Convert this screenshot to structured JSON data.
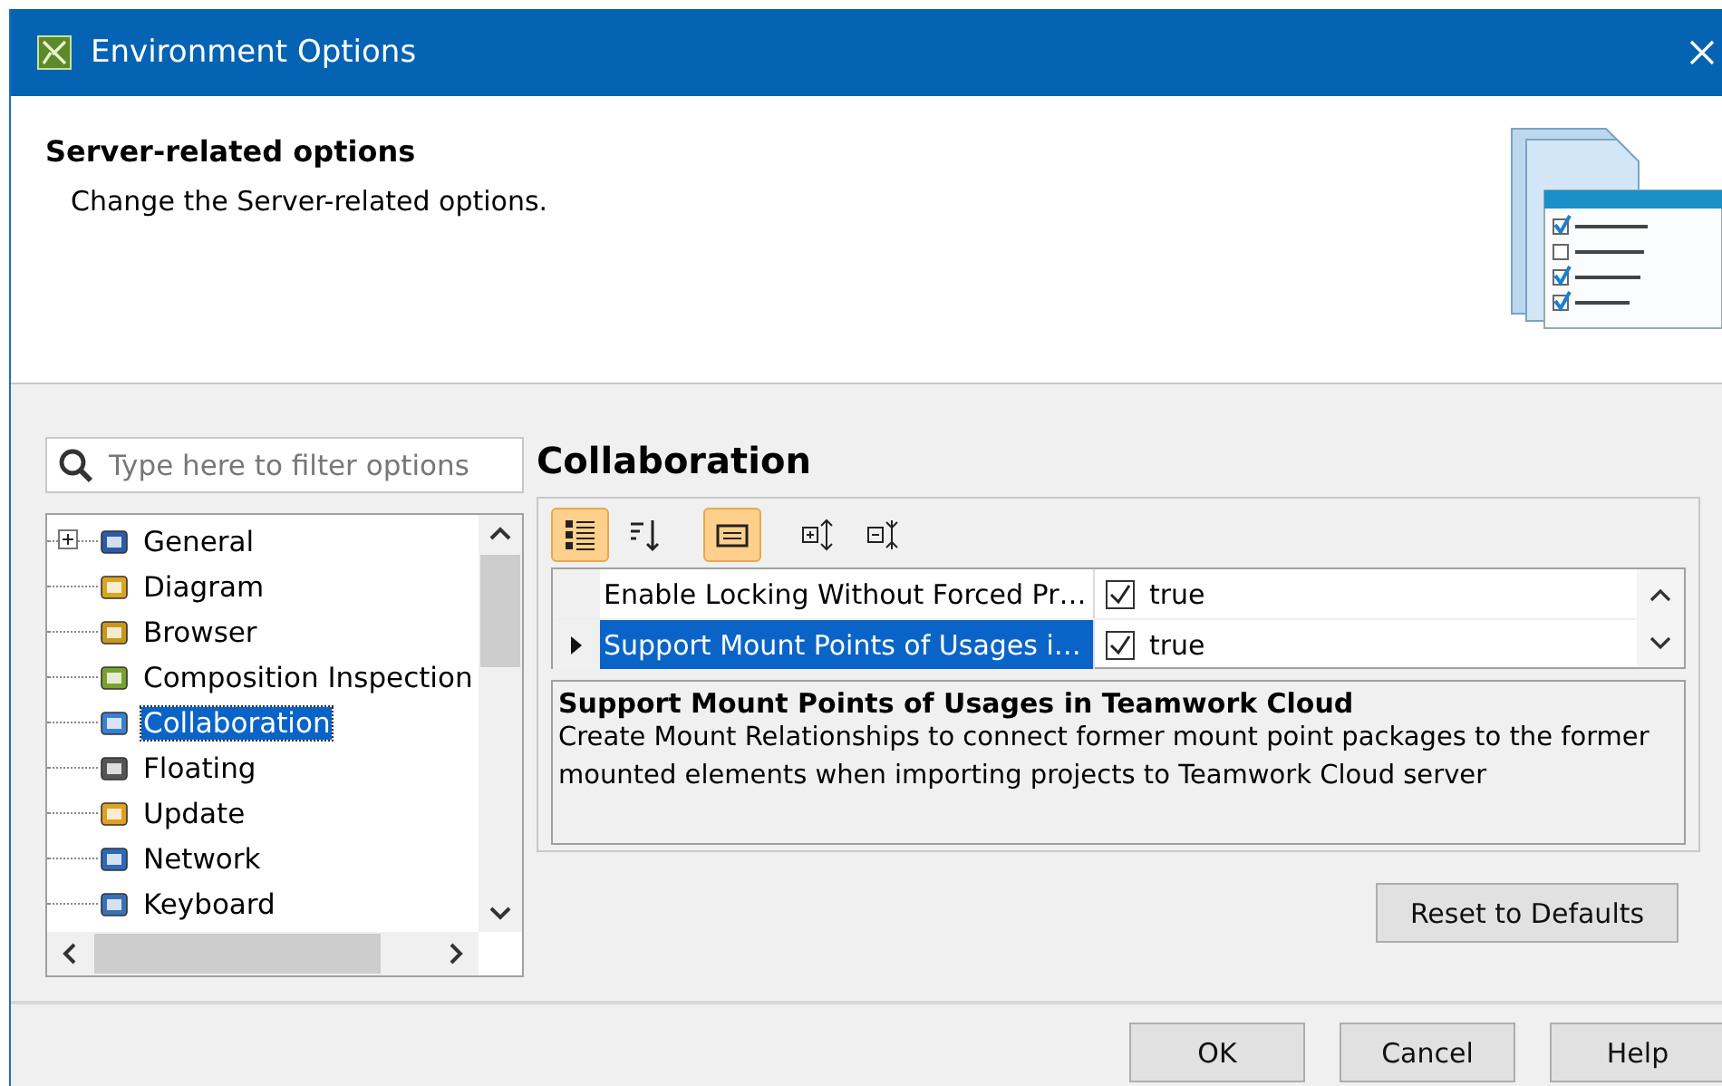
{
  "window": {
    "title": "Environment Options"
  },
  "header": {
    "title": "Server-related options",
    "subtitle": "Change the Server-related options."
  },
  "filter": {
    "placeholder": "Type here to filter options"
  },
  "tree": {
    "items": [
      {
        "label": "General",
        "selected": false,
        "expanded": false
      },
      {
        "label": "Diagram",
        "selected": false
      },
      {
        "label": "Browser",
        "selected": false
      },
      {
        "label": "Composition Inspection",
        "selected": false
      },
      {
        "label": "Collaboration",
        "selected": true
      },
      {
        "label": "Floating",
        "selected": false
      },
      {
        "label": "Update",
        "selected": false
      },
      {
        "label": "Network",
        "selected": false
      },
      {
        "label": "Keyboard",
        "selected": false
      }
    ]
  },
  "panel": {
    "title": "Collaboration",
    "toolbar": [
      {
        "kind": "categorized",
        "selected": true
      },
      {
        "kind": "sort",
        "selected": false
      },
      {
        "kind": "description",
        "selected": true
      },
      {
        "kind": "expand",
        "selected": false
      },
      {
        "kind": "collapse",
        "selected": false
      }
    ],
    "properties": [
      {
        "name": "Enable Locking Without Forced Pr…",
        "checked": true,
        "value": "true",
        "selected": false
      },
      {
        "name": "Support Mount Points of Usages i…",
        "checked": true,
        "value": "true",
        "selected": true
      }
    ],
    "description": {
      "title": "Support Mount Points of Usages in Teamwork Cloud",
      "text": "Create Mount Relationships to connect former mount point packages to the former mounted elements when importing projects to Teamwork Cloud server"
    },
    "reset_button": "Reset to Defaults"
  },
  "buttons": [
    "OK",
    "Cancel",
    "Help"
  ]
}
